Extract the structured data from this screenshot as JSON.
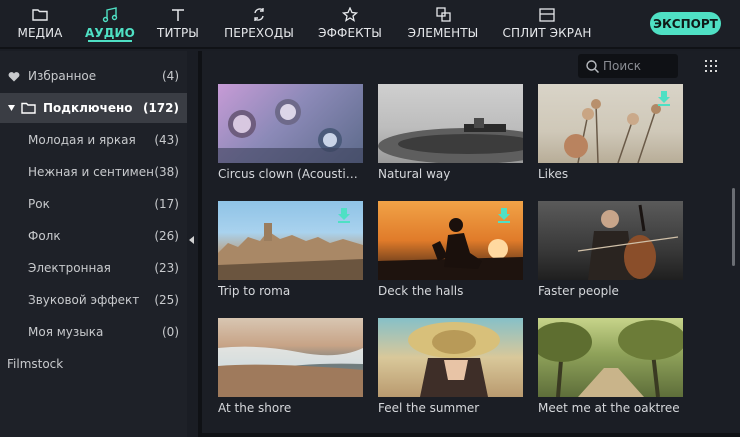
{
  "toolbar": {
    "tabs": [
      {
        "label": "МЕДИА",
        "icon": "folder-icon"
      },
      {
        "label": "АУДИО",
        "icon": "music-note-icon",
        "active": true
      },
      {
        "label": "ТИТРЫ",
        "icon": "text-icon"
      },
      {
        "label": "ПЕРЕХОДЫ",
        "icon": "transition-icon"
      },
      {
        "label": "ЭФФЕКТЫ",
        "icon": "effects-star-icon"
      },
      {
        "label": "ЭЛЕМЕНТЫ",
        "icon": "elements-icon"
      },
      {
        "label": "СПЛИТ ЭКРАН",
        "icon": "split-screen-icon"
      }
    ],
    "export_label": "ЭКСПОРТ",
    "accent": "#4fe0c4"
  },
  "sidebar": {
    "favorites": {
      "label": "Избранное",
      "count": "(4)"
    },
    "connected": {
      "label": "Подключено",
      "count": "(172)"
    },
    "items": [
      {
        "label": "Молодая и яркая",
        "count": "(43)"
      },
      {
        "label": "Нежная и сентимента",
        "count": "(38)"
      },
      {
        "label": "Рок",
        "count": "(17)"
      },
      {
        "label": "Фолк",
        "count": "(26)"
      },
      {
        "label": "Электронная",
        "count": "(23)"
      },
      {
        "label": "Звуковой эффект",
        "count": "(25)"
      },
      {
        "label": "Моя музыка",
        "count": "(0)"
      }
    ],
    "filmstock": "Filmstock"
  },
  "search": {
    "placeholder": "Поиск"
  },
  "tracks": [
    {
      "title": "Circus clown (Acoustic v...",
      "download": false
    },
    {
      "title": "Natural way",
      "download": false
    },
    {
      "title": "Likes",
      "download": true
    },
    {
      "title": "Trip to roma",
      "download": true
    },
    {
      "title": "Deck the halls",
      "download": true
    },
    {
      "title": "Faster people",
      "download": false
    },
    {
      "title": "At the shore",
      "download": false
    },
    {
      "title": "Feel the summer",
      "download": false
    },
    {
      "title": "Meet me at the oaktree",
      "download": false
    }
  ]
}
